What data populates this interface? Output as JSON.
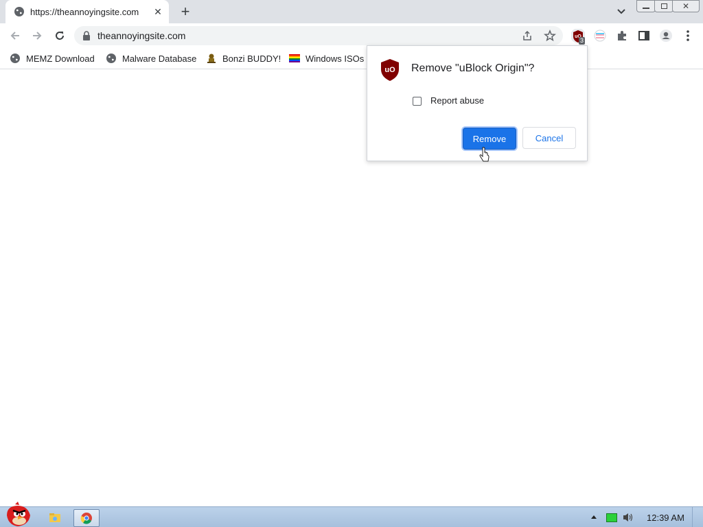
{
  "browser": {
    "tab": {
      "title": "https://theannoyingsite.com",
      "favicon": "globe-icon"
    },
    "address": {
      "url": "theannoyingsite.com"
    },
    "extensions": {
      "ublock_badge": "3"
    },
    "bookmarks": [
      {
        "label": "MEMZ Download",
        "icon": "globe-icon"
      },
      {
        "label": "Malware Database",
        "icon": "globe-icon"
      },
      {
        "label": "Bonzi BUDDY!",
        "icon": "bonzi-icon"
      },
      {
        "label": "Windows ISOs",
        "icon": "rainbow-flag-icon"
      }
    ]
  },
  "dialog": {
    "title": "Remove \"uBlock Origin\"?",
    "checkbox_label": "Report abuse",
    "checkbox_checked": false,
    "remove_label": "Remove",
    "cancel_label": "Cancel"
  },
  "taskbar": {
    "clock": "12:39 AM"
  },
  "colors": {
    "accent": "#1a73e8",
    "ublock": "#800000",
    "taskbar": "#b3c9e3"
  }
}
